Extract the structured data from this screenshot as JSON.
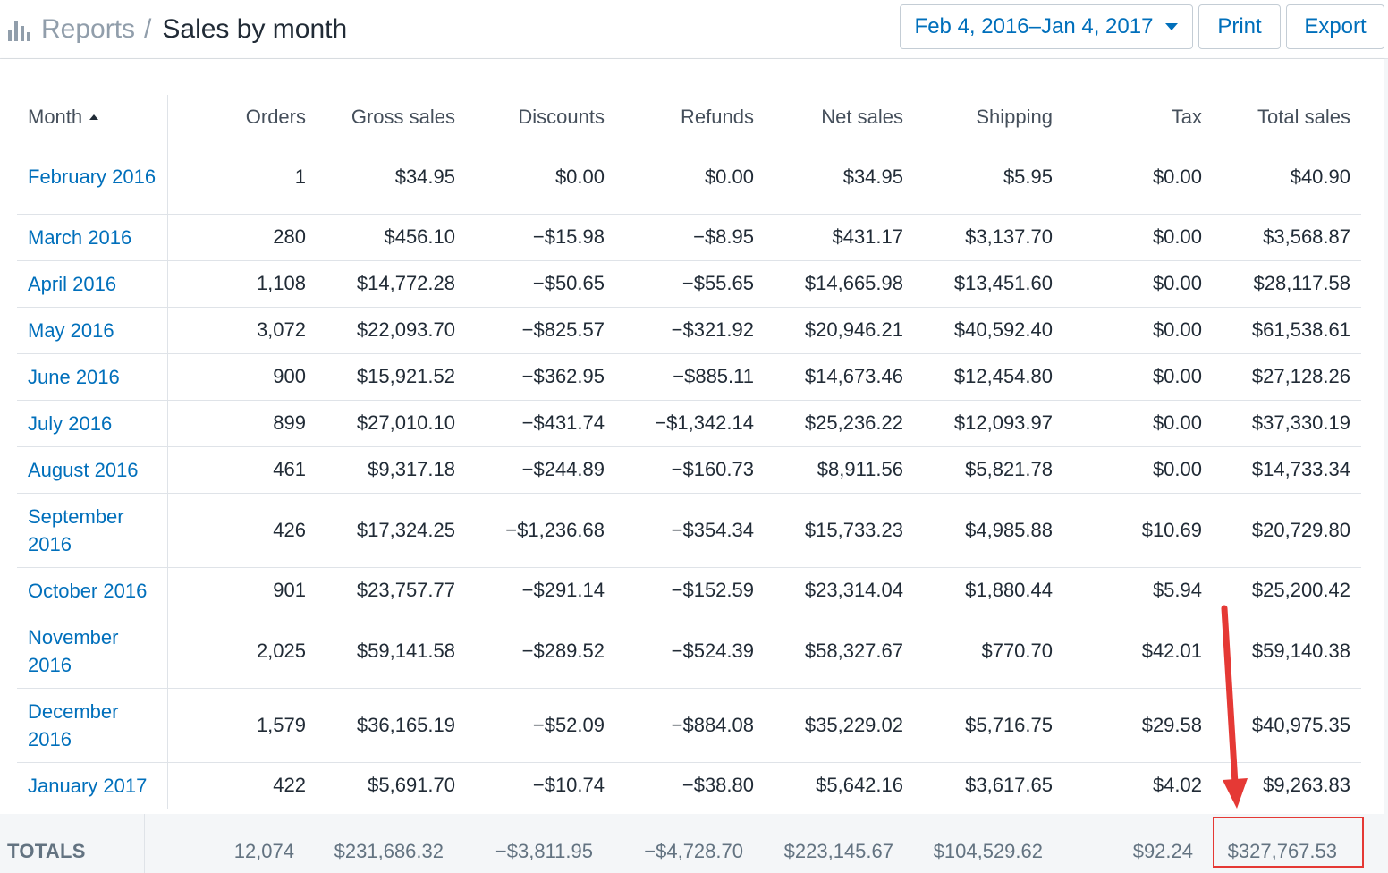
{
  "header": {
    "breadcrumb_root": "Reports",
    "breadcrumb_sep": "/",
    "title": "Sales by month",
    "date_range": "Feb 4, 2016–Jan 4, 2017",
    "print_label": "Print",
    "export_label": "Export"
  },
  "table": {
    "columns": [
      "Month",
      "Orders",
      "Gross sales",
      "Discounts",
      "Refunds",
      "Net sales",
      "Shipping",
      "Tax",
      "Total sales"
    ],
    "sort_column": "Month",
    "sort_direction": "ascending",
    "rows": [
      [
        "February 2016",
        "1",
        "$34.95",
        "$0.00",
        "$0.00",
        "$34.95",
        "$5.95",
        "$0.00",
        "$40.90"
      ],
      [
        "March 2016",
        "280",
        "$456.10",
        "−$15.98",
        "−$8.95",
        "$431.17",
        "$3,137.70",
        "$0.00",
        "$3,568.87"
      ],
      [
        "April 2016",
        "1,108",
        "$14,772.28",
        "−$50.65",
        "−$55.65",
        "$14,665.98",
        "$13,451.60",
        "$0.00",
        "$28,117.58"
      ],
      [
        "May 2016",
        "3,072",
        "$22,093.70",
        "−$825.57",
        "−$321.92",
        "$20,946.21",
        "$40,592.40",
        "$0.00",
        "$61,538.61"
      ],
      [
        "June 2016",
        "900",
        "$15,921.52",
        "−$362.95",
        "−$885.11",
        "$14,673.46",
        "$12,454.80",
        "$0.00",
        "$27,128.26"
      ],
      [
        "July 2016",
        "899",
        "$27,010.10",
        "−$431.74",
        "−$1,342.14",
        "$25,236.22",
        "$12,093.97",
        "$0.00",
        "$37,330.19"
      ],
      [
        "August 2016",
        "461",
        "$9,317.18",
        "−$244.89",
        "−$160.73",
        "$8,911.56",
        "$5,821.78",
        "$0.00",
        "$14,733.34"
      ],
      [
        "September 2016",
        "426",
        "$17,324.25",
        "−$1,236.68",
        "−$354.34",
        "$15,733.23",
        "$4,985.88",
        "$10.69",
        "$20,729.80"
      ],
      [
        "October 2016",
        "901",
        "$23,757.77",
        "−$291.14",
        "−$152.59",
        "$23,314.04",
        "$1,880.44",
        "$5.94",
        "$25,200.42"
      ],
      [
        "November 2016",
        "2,025",
        "$59,141.58",
        "−$289.52",
        "−$524.39",
        "$58,327.67",
        "$770.70",
        "$42.01",
        "$59,140.38"
      ],
      [
        "December 2016",
        "1,579",
        "$36,165.19",
        "−$52.09",
        "−$884.08",
        "$35,229.02",
        "$5,716.75",
        "$29.58",
        "$40,975.35"
      ],
      [
        "January 2017",
        "422",
        "$5,691.70",
        "−$10.74",
        "−$38.80",
        "$5,642.16",
        "$3,617.65",
        "$4.02",
        "$9,263.83"
      ]
    ],
    "totals": {
      "label": "TOTALS",
      "values": [
        "12,074",
        "$231,686.32",
        "−$3,811.95",
        "−$4,728.70",
        "$223,145.67",
        "$104,529.62",
        "$92.24",
        "$327,767.53"
      ]
    }
  },
  "colors": {
    "link": "#006fbb",
    "text": "#212b36",
    "muted": "#919eab",
    "border": "#dfe3e8",
    "totals_bg": "#f4f6f8",
    "annotation": "#e53935"
  },
  "icons": {
    "reports": "bar-chart-icon",
    "dropdown": "caret-down-icon",
    "sort": "sort-ascending-icon",
    "annotation": "red-arrow-icon"
  }
}
